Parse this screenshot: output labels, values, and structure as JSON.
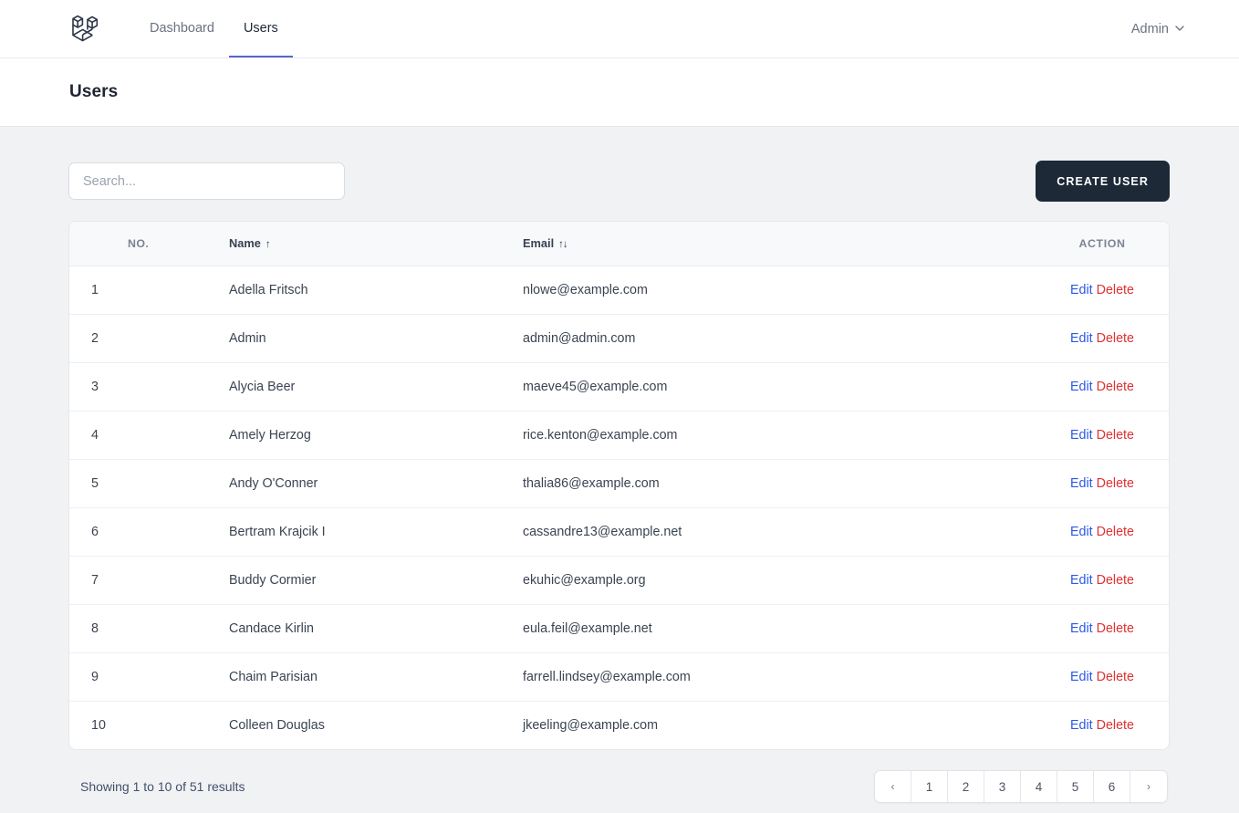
{
  "navbar": {
    "brand_icon": "laravel-logo-icon",
    "links": [
      {
        "label": "Dashboard",
        "active": false
      },
      {
        "label": "Users",
        "active": true
      }
    ],
    "user_menu": {
      "label": "Admin",
      "chevron_icon": "chevron-down-icon"
    }
  },
  "page": {
    "title": "Users"
  },
  "toolbar": {
    "search_placeholder": "Search...",
    "search_value": "",
    "search_icon": "search-icon",
    "create_label": "Create User"
  },
  "table": {
    "columns": [
      {
        "key": "no",
        "label": "NO.",
        "sort": ""
      },
      {
        "key": "name",
        "label": "Name",
        "sort": "↑"
      },
      {
        "key": "email",
        "label": "Email",
        "sort": "↑↓"
      },
      {
        "key": "action",
        "label": "ACTION",
        "sort": ""
      }
    ],
    "rows": [
      {
        "no": "1",
        "name": "Adella Fritsch",
        "email": "nlowe@example.com"
      },
      {
        "no": "2",
        "name": "Admin",
        "email": "admin@admin.com"
      },
      {
        "no": "3",
        "name": "Alycia Beer",
        "email": "maeve45@example.com"
      },
      {
        "no": "4",
        "name": "Amely Herzog",
        "email": "rice.kenton@example.com"
      },
      {
        "no": "5",
        "name": "Andy O'Conner",
        "email": "thalia86@example.com"
      },
      {
        "no": "6",
        "name": "Bertram Krajcik I",
        "email": "cassandre13@example.net"
      },
      {
        "no": "7",
        "name": "Buddy Cormier",
        "email": "ekuhic@example.org"
      },
      {
        "no": "8",
        "name": "Candace Kirlin",
        "email": "eula.feil@example.net"
      },
      {
        "no": "9",
        "name": "Chaim Parisian",
        "email": "farrell.lindsey@example.com"
      },
      {
        "no": "10",
        "name": "Colleen Douglas",
        "email": "jkeeling@example.com"
      }
    ],
    "actions": {
      "edit_label": "Edit",
      "delete_label": "Delete"
    }
  },
  "footer": {
    "showing_text": "Showing 1 to 10 of 51 results",
    "pagination": {
      "prev_icon": "chevron-left-icon",
      "next_icon": "chevron-right-icon",
      "prev_label": "‹",
      "next_label": "›",
      "pages": [
        "1",
        "2",
        "3",
        "4",
        "5",
        "6"
      ],
      "current": "1"
    }
  },
  "colors": {
    "accent": "#5b63d3",
    "button_bg": "#1e2937",
    "edit_link": "#2b58e8",
    "delete_link": "#e03131",
    "page_bg": "#f1f2f4",
    "card_bg": "#ffffff"
  }
}
